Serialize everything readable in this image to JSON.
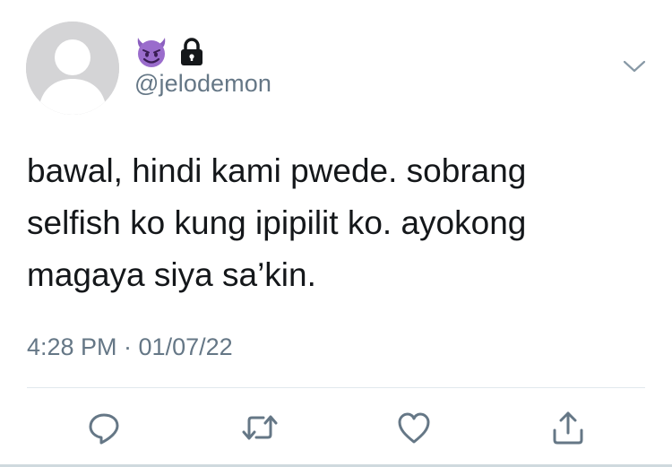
{
  "user": {
    "display_name_icons": [
      "smiling-devil-emoji",
      "lock-icon"
    ],
    "handle": "@jelodemon",
    "avatar": "default-profile-icon"
  },
  "tweet": {
    "text": "bawal, hindi kami pwede. sobrang\nselfish ko kung ipipilit ko. ayokong\nmagaya siya sa’kin.",
    "timestamp": "4:28 PM · 01/07/22"
  },
  "actions": [
    "reply-icon",
    "retweet-icon",
    "like-icon",
    "share-icon"
  ],
  "colors": {
    "text": "#14171a",
    "secondary": "#657786",
    "icon": "#657786",
    "avatar_bg": "#d4d4d6",
    "devil_purple": "#8b5fbf"
  }
}
